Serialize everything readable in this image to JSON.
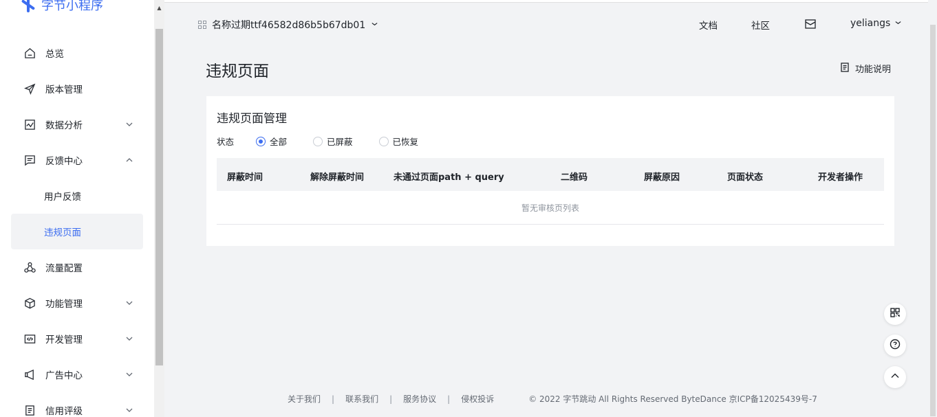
{
  "brand": {
    "logo_text": "字节小程序"
  },
  "sidebar": {
    "items": [
      {
        "label": "总览"
      },
      {
        "label": "版本管理"
      },
      {
        "label": "数据分析"
      },
      {
        "label": "反馈中心"
      },
      {
        "label": "用户反馈"
      },
      {
        "label": "违规页面"
      },
      {
        "label": "流量配置"
      },
      {
        "label": "功能管理"
      },
      {
        "label": "开发管理"
      },
      {
        "label": "广告中心"
      },
      {
        "label": "信用评级"
      }
    ]
  },
  "header": {
    "app_name": "名称过期ttf46582d86b5b67db01",
    "docs": "文档",
    "community": "社区",
    "username": "yeliangs"
  },
  "page": {
    "title": "违规页面",
    "help_label": "功能说明",
    "card_title": "违规页面管理",
    "filter": {
      "label": "状态",
      "options": [
        "全部",
        "已屏蔽",
        "已恢复"
      ],
      "selected": "全部"
    },
    "table": {
      "columns": [
        "屏蔽时间",
        "解除屏蔽时间",
        "未通过页面path + query",
        "二维码",
        "屏蔽原因",
        "页面状态",
        "开发者操作"
      ],
      "empty_text": "暂无审核页列表"
    }
  },
  "footer": {
    "links": [
      "关于我们",
      "联系我们",
      "服务协议",
      "侵权投诉"
    ],
    "copyright": "© 2022 字节跳动 All Rights Reserved ByteDance 京ICP备12025439号-7"
  },
  "colors": {
    "accent": "#3c6df0",
    "background": "#f2f3f5"
  }
}
